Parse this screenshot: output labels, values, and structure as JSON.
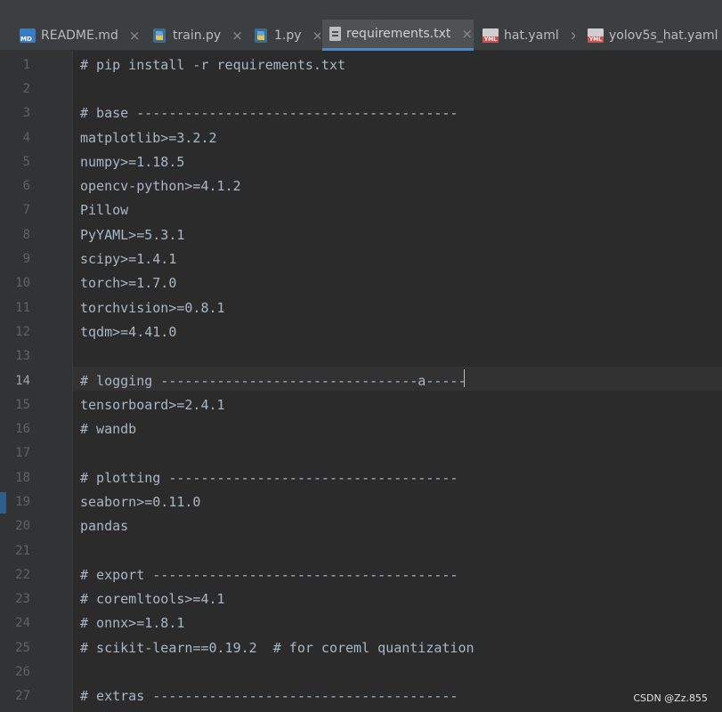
{
  "tabs": [
    {
      "label": "README.md",
      "icon": "markdown-file-icon",
      "active": false
    },
    {
      "label": "train.py",
      "icon": "python-file-icon",
      "active": false
    },
    {
      "label": "1.py",
      "icon": "python-file-icon",
      "active": false
    },
    {
      "label": "requirements.txt",
      "icon": "text-file-icon",
      "active": true
    },
    {
      "label": "hat.yaml",
      "icon": "yaml-file-icon",
      "active": false
    },
    {
      "label": "yolov5s_hat.yaml",
      "icon": "yaml-file-icon",
      "active": false
    }
  ],
  "editor": {
    "current_line": 14,
    "lines": [
      {
        "num": "1",
        "text": "# pip install -r requirements.txt"
      },
      {
        "num": "2",
        "text": ""
      },
      {
        "num": "3",
        "text": "# base ----------------------------------------"
      },
      {
        "num": "4",
        "text": "matplotlib>=3.2.2"
      },
      {
        "num": "5",
        "text": "numpy>=1.18.5"
      },
      {
        "num": "6",
        "text": "opencv-python>=4.1.2"
      },
      {
        "num": "7",
        "text": "Pillow"
      },
      {
        "num": "8",
        "text": "PyYAML>=5.3.1"
      },
      {
        "num": "9",
        "text": "scipy>=1.4.1"
      },
      {
        "num": "10",
        "text": "torch>=1.7.0"
      },
      {
        "num": "11",
        "text": "torchvision>=0.8.1"
      },
      {
        "num": "12",
        "text": "tqdm>=4.41.0"
      },
      {
        "num": "13",
        "text": ""
      },
      {
        "num": "14",
        "text": "# logging --------------------------------a-----"
      },
      {
        "num": "15",
        "text": "tensorboard>=2.4.1"
      },
      {
        "num": "16",
        "text": "# wandb"
      },
      {
        "num": "17",
        "text": ""
      },
      {
        "num": "18",
        "text": "# plotting ------------------------------------"
      },
      {
        "num": "19",
        "text": "seaborn>=0.11.0"
      },
      {
        "num": "20",
        "text": "pandas"
      },
      {
        "num": "21",
        "text": ""
      },
      {
        "num": "22",
        "text": "# export --------------------------------------"
      },
      {
        "num": "23",
        "text": "# coremltools>=4.1"
      },
      {
        "num": "24",
        "text": "# onnx>=1.8.1"
      },
      {
        "num": "25",
        "text": "# scikit-learn==0.19.2  # for coreml quantization"
      },
      {
        "num": "26",
        "text": ""
      },
      {
        "num": "27",
        "text": "# extras --------------------------------------"
      }
    ]
  },
  "watermark": "CSDN @Zz.855",
  "colors": {
    "editor_bg": "#2b2b2b",
    "gutter_bg": "#313335",
    "tab_bar_bg": "#3c3f41",
    "active_tab_bg": "#4e5254",
    "active_tab_underline": "#4a88c7",
    "code_text": "#a9b7c6",
    "line_number": "#606366"
  }
}
